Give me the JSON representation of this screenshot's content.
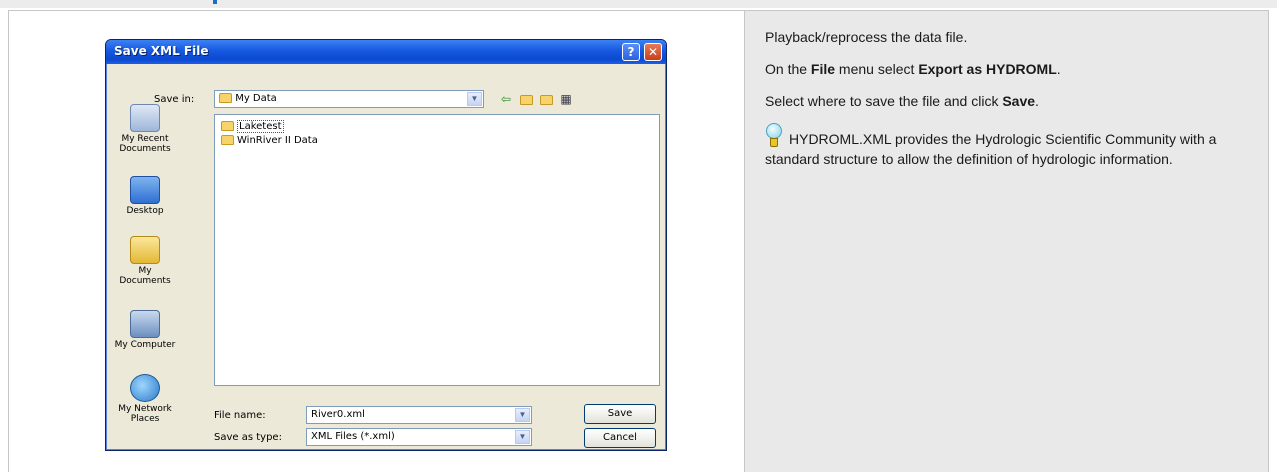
{
  "dialog": {
    "title": "Save XML File",
    "help_glyph": "?",
    "close_glyph": "✕",
    "save_in_label": "Save in:",
    "save_in_value": "My Data",
    "places": [
      {
        "label": "My Recent Documents",
        "icon": "recent-documents-icon"
      },
      {
        "label": "Desktop",
        "icon": "desktop-icon"
      },
      {
        "label": "My Documents",
        "icon": "my-documents-icon"
      },
      {
        "label": "My Computer",
        "icon": "my-computer-icon"
      },
      {
        "label": "My Network Places",
        "icon": "network-places-icon"
      }
    ],
    "files": [
      "Laketest",
      "WinRiver II Data"
    ],
    "file_name_label": "File name:",
    "file_name_value": "River0.xml",
    "save_as_type_label": "Save as type:",
    "save_as_type_value": "XML Files (*.xml)",
    "save_button": "Save",
    "cancel_button": "Cancel"
  },
  "instructions": {
    "line1": "Playback/reprocess the data file.",
    "line2_pre": "On the ",
    "line2_menu": "File",
    "line2_mid": " menu select ",
    "line2_item": "Export as HYDROML",
    "line2_post": ".",
    "line3_pre": "Select where to save the file and click ",
    "line3_button": "Save",
    "line3_post": ".",
    "tip": "HYDROML.XML provides the Hydrologic Scientific Community with a standard structure to allow the definition of hydrologic information."
  },
  "colors": {
    "titlebar": "#0b49d0",
    "right_panel": "#e9e9e9",
    "accent": "#1b6fc2"
  }
}
